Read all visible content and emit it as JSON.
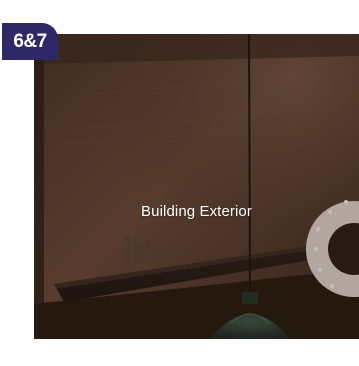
{
  "badge": {
    "label": "6&7",
    "color": "#2f2766"
  },
  "card": {
    "title": "Building Exterior",
    "icon": "pendant-lamp-photo"
  }
}
